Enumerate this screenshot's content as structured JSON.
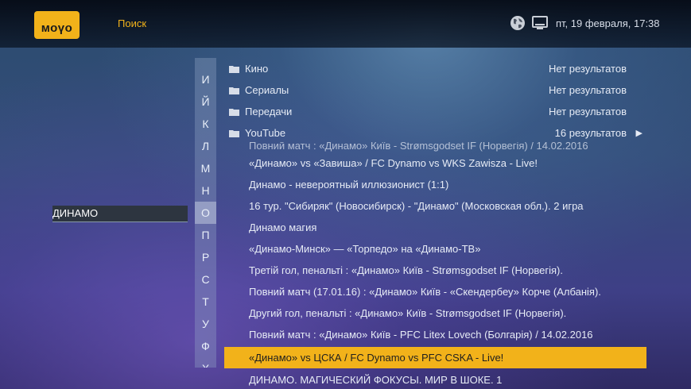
{
  "header": {
    "logo_text": "моүо",
    "title": "Поиск",
    "datetime": "пт, 19 февраля, 17:38",
    "icons": [
      "globe-icon",
      "tv-icon"
    ],
    "accent_color": "#f2b21a"
  },
  "search": {
    "query": "ДИНАМО"
  },
  "keyboard": {
    "letters": [
      "И",
      "Й",
      "К",
      "Л",
      "М",
      "Н",
      "О",
      "П",
      "Р",
      "С",
      "Т",
      "У",
      "Ф",
      "Х"
    ],
    "selected": "О"
  },
  "categories": [
    {
      "label": "Кино",
      "count": "Нет результатов"
    },
    {
      "label": "Сериалы",
      "count": "Нет результатов"
    },
    {
      "label": "Передачи",
      "count": "Нет результатов"
    },
    {
      "label": "YouTube",
      "count": "16 результатов",
      "arrow": "▶"
    }
  ],
  "results": [
    {
      "title": "Повний матч : «Динамо» Київ - Strømsgodset IF (Норвегія) / 14.02.2016"
    },
    {
      "title": "«Динамо» vs «Завиша» / FC Dynamo vs WKS Zawisza - Live!"
    },
    {
      "title": "Динамо - невероятный иллюзионист (1:1)"
    },
    {
      "title": "16 тур. \"Сибиряк\" (Новосибирск) - \"Динамо\" (Московская обл.). 2 игра"
    },
    {
      "title": "Динамо магия"
    },
    {
      "title": "«Динамо-Минск» — «Торпедо» на «Динамо-ТВ»"
    },
    {
      "title": "Третій гол, пенальті : «Динамо» Київ - Strømsgodset IF  (Норвегія)."
    },
    {
      "title": "Повний матч (17.01.16) : «Динамо» Київ - «Скендербеу» Корче (Албанія)."
    },
    {
      "title": "Другий гол, пенальті : «Динамо» Київ - Strømsgodset IF  (Норвегія)."
    },
    {
      "title": "Повний матч : «Динамо» Київ - PFC Litex Lovech (Болгарія) / 14.02.2016"
    },
    {
      "title": "«Динамо» vs ЦСКА / FC Dynamo vs PFC CSKA - Live!",
      "selected": true
    },
    {
      "title": "ДИНАМО. МАГИЧЕСКИЙ ФОКУСЫ. МИР В ШОКЕ. 1"
    }
  ]
}
